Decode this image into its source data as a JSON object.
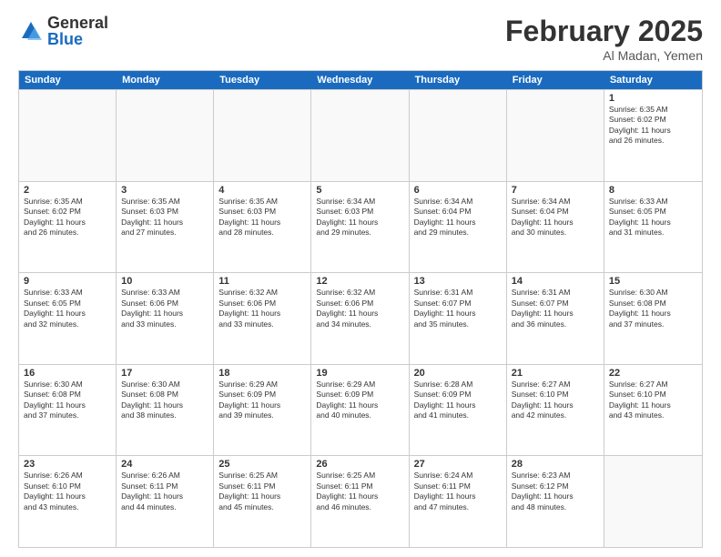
{
  "logo": {
    "general": "General",
    "blue": "Blue"
  },
  "title": {
    "month": "February 2025",
    "location": "Al Madan, Yemen"
  },
  "weekdays": [
    "Sunday",
    "Monday",
    "Tuesday",
    "Wednesday",
    "Thursday",
    "Friday",
    "Saturday"
  ],
  "weeks": [
    [
      {
        "day": "",
        "info": ""
      },
      {
        "day": "",
        "info": ""
      },
      {
        "day": "",
        "info": ""
      },
      {
        "day": "",
        "info": ""
      },
      {
        "day": "",
        "info": ""
      },
      {
        "day": "",
        "info": ""
      },
      {
        "day": "1",
        "info": "Sunrise: 6:35 AM\nSunset: 6:02 PM\nDaylight: 11 hours\nand 26 minutes."
      }
    ],
    [
      {
        "day": "2",
        "info": "Sunrise: 6:35 AM\nSunset: 6:02 PM\nDaylight: 11 hours\nand 26 minutes."
      },
      {
        "day": "3",
        "info": "Sunrise: 6:35 AM\nSunset: 6:03 PM\nDaylight: 11 hours\nand 27 minutes."
      },
      {
        "day": "4",
        "info": "Sunrise: 6:35 AM\nSunset: 6:03 PM\nDaylight: 11 hours\nand 28 minutes."
      },
      {
        "day": "5",
        "info": "Sunrise: 6:34 AM\nSunset: 6:03 PM\nDaylight: 11 hours\nand 29 minutes."
      },
      {
        "day": "6",
        "info": "Sunrise: 6:34 AM\nSunset: 6:04 PM\nDaylight: 11 hours\nand 29 minutes."
      },
      {
        "day": "7",
        "info": "Sunrise: 6:34 AM\nSunset: 6:04 PM\nDaylight: 11 hours\nand 30 minutes."
      },
      {
        "day": "8",
        "info": "Sunrise: 6:33 AM\nSunset: 6:05 PM\nDaylight: 11 hours\nand 31 minutes."
      }
    ],
    [
      {
        "day": "9",
        "info": "Sunrise: 6:33 AM\nSunset: 6:05 PM\nDaylight: 11 hours\nand 32 minutes."
      },
      {
        "day": "10",
        "info": "Sunrise: 6:33 AM\nSunset: 6:06 PM\nDaylight: 11 hours\nand 33 minutes."
      },
      {
        "day": "11",
        "info": "Sunrise: 6:32 AM\nSunset: 6:06 PM\nDaylight: 11 hours\nand 33 minutes."
      },
      {
        "day": "12",
        "info": "Sunrise: 6:32 AM\nSunset: 6:06 PM\nDaylight: 11 hours\nand 34 minutes."
      },
      {
        "day": "13",
        "info": "Sunrise: 6:31 AM\nSunset: 6:07 PM\nDaylight: 11 hours\nand 35 minutes."
      },
      {
        "day": "14",
        "info": "Sunrise: 6:31 AM\nSunset: 6:07 PM\nDaylight: 11 hours\nand 36 minutes."
      },
      {
        "day": "15",
        "info": "Sunrise: 6:30 AM\nSunset: 6:08 PM\nDaylight: 11 hours\nand 37 minutes."
      }
    ],
    [
      {
        "day": "16",
        "info": "Sunrise: 6:30 AM\nSunset: 6:08 PM\nDaylight: 11 hours\nand 37 minutes."
      },
      {
        "day": "17",
        "info": "Sunrise: 6:30 AM\nSunset: 6:08 PM\nDaylight: 11 hours\nand 38 minutes."
      },
      {
        "day": "18",
        "info": "Sunrise: 6:29 AM\nSunset: 6:09 PM\nDaylight: 11 hours\nand 39 minutes."
      },
      {
        "day": "19",
        "info": "Sunrise: 6:29 AM\nSunset: 6:09 PM\nDaylight: 11 hours\nand 40 minutes."
      },
      {
        "day": "20",
        "info": "Sunrise: 6:28 AM\nSunset: 6:09 PM\nDaylight: 11 hours\nand 41 minutes."
      },
      {
        "day": "21",
        "info": "Sunrise: 6:27 AM\nSunset: 6:10 PM\nDaylight: 11 hours\nand 42 minutes."
      },
      {
        "day": "22",
        "info": "Sunrise: 6:27 AM\nSunset: 6:10 PM\nDaylight: 11 hours\nand 43 minutes."
      }
    ],
    [
      {
        "day": "23",
        "info": "Sunrise: 6:26 AM\nSunset: 6:10 PM\nDaylight: 11 hours\nand 43 minutes."
      },
      {
        "day": "24",
        "info": "Sunrise: 6:26 AM\nSunset: 6:11 PM\nDaylight: 11 hours\nand 44 minutes."
      },
      {
        "day": "25",
        "info": "Sunrise: 6:25 AM\nSunset: 6:11 PM\nDaylight: 11 hours\nand 45 minutes."
      },
      {
        "day": "26",
        "info": "Sunrise: 6:25 AM\nSunset: 6:11 PM\nDaylight: 11 hours\nand 46 minutes."
      },
      {
        "day": "27",
        "info": "Sunrise: 6:24 AM\nSunset: 6:11 PM\nDaylight: 11 hours\nand 47 minutes."
      },
      {
        "day": "28",
        "info": "Sunrise: 6:23 AM\nSunset: 6:12 PM\nDaylight: 11 hours\nand 48 minutes."
      },
      {
        "day": "",
        "info": ""
      }
    ]
  ]
}
